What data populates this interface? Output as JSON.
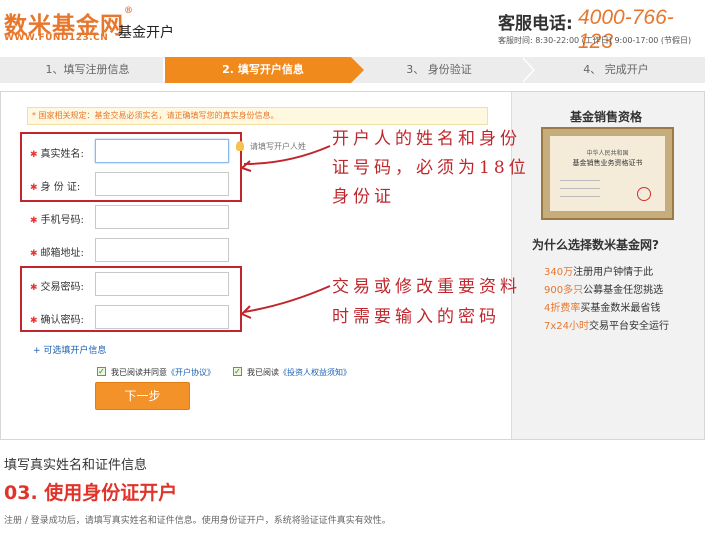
{
  "header": {
    "logo_text": "数米基金网",
    "logo_mark": "®",
    "logo_url": "WWW.FUND123.CN",
    "title": "基金开户",
    "hotline_label": "客服电话:",
    "hotline_number": "4000-766-123",
    "service_hours": "客服时间: 8:30-22:00 (工作日) 9:00-17:00 (节假日)"
  },
  "steps": [
    {
      "label": "1、填写注册信息",
      "active": false
    },
    {
      "label": "2. 填写开户信息",
      "active": true
    },
    {
      "label": "3、 身份验证",
      "active": false
    },
    {
      "label": "4、 完成开户",
      "active": false
    }
  ],
  "form": {
    "notice": "* 国家相关规定：基金交易必须实名，请正确填写您的真实身份信息。",
    "fields": [
      {
        "label": "真实姓名:",
        "value": "",
        "required": true
      },
      {
        "label": "身 份 证:",
        "value": "",
        "required": true
      },
      {
        "label": "手机号码:",
        "value": "",
        "required": true
      },
      {
        "label": "邮箱地址:",
        "value": "",
        "required": true
      },
      {
        "label": "交易密码:",
        "value": "",
        "required": true
      },
      {
        "label": "确认密码:",
        "value": "",
        "required": true
      }
    ],
    "name_hint": "请填写开户人姓",
    "optional_link": "+ 可选填开户信息",
    "agreements": [
      {
        "prefix": "我已阅读并同意",
        "link": "《开户协议》",
        "checked": true
      },
      {
        "prefix": "我已阅读",
        "link": "《投资人权益须知》",
        "checked": true
      }
    ],
    "next_button": "下一步"
  },
  "annotations": {
    "identity_line1": "开户人的姓名和身份",
    "identity_line2": "证号码，必须为18位",
    "identity_line3": "身份证",
    "password_line1": "交易或修改重要资料",
    "password_line2": "时需要输入的密码"
  },
  "sidebar": {
    "title": "基金销售资格",
    "certificate_line1": "中华人民共和国",
    "certificate_line2": "基金销售业务资格证书",
    "why_title": "为什么选择数米基金网?",
    "features": [
      {
        "highlight": "340万",
        "text": "注册用户钟情于此"
      },
      {
        "highlight": "900多只",
        "text": "公募基金任您挑选"
      },
      {
        "highlight": "4折费率",
        "text": "买基金数米最省钱"
      },
      {
        "highlight": "7x24小时",
        "text": "交易平台安全运行"
      }
    ]
  },
  "footer": {
    "subtitle": "填写真实姓名和证件信息",
    "heading": "03. 使用身份证开户",
    "description": "注册 / 登录成功后，请填写真实姓名和证件信息。使用身份证开户，系统将验证证件真实有效性。"
  },
  "colors": {
    "brand_orange": "#e8772e",
    "step_active": "#f08a1c",
    "annotation_red": "#c0272d",
    "link_blue": "#1a5fb4"
  }
}
